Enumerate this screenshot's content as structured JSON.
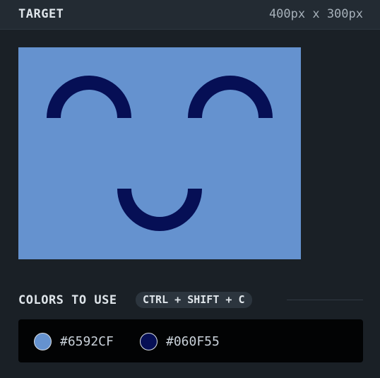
{
  "header": {
    "title": "TARGET",
    "dimensions": "400px x 300px"
  },
  "target": {
    "background": "#6592CF",
    "foreground": "#060F55"
  },
  "colors": {
    "label": "COLORS TO USE",
    "shortcut": "CTRL + SHIFT + C",
    "swatches": [
      {
        "color": "#6592CF",
        "hex": "#6592CF"
      },
      {
        "color": "#060F55",
        "hex": "#060F55"
      }
    ]
  }
}
